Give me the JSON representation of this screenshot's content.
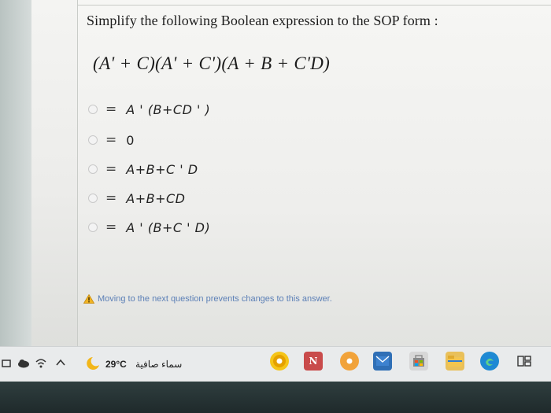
{
  "question": {
    "prompt": "Simplify the following Boolean expression to the SOP form :",
    "expression": "(A' + C)(A' + C')(A + B + C'D)"
  },
  "options": [
    {
      "equals": "=",
      "text": "A ' (B+CD ' )"
    },
    {
      "equals": "=",
      "text": "0"
    },
    {
      "equals": "=",
      "text": "A+B+C ' D"
    },
    {
      "equals": "=",
      "text": "A+B+CD"
    },
    {
      "equals": "=",
      "text": "A ' (B+C ' D)"
    }
  ],
  "warning": {
    "icon": "warning-triangle-icon",
    "text": "Moving to the next question prevents changes to this answer."
  },
  "taskbar": {
    "weather_temp": "29°C",
    "weather_label": "سماء صافية",
    "icons": [
      "snip-icon",
      "cloud-icon",
      "wifi-icon",
      "chevron-up-icon",
      "weather-icon",
      "chrome-icon",
      "word-icon",
      "chrome-alt-icon",
      "mail-icon",
      "store-icon",
      "file-explorer-icon",
      "edge-icon",
      "task-view-icon"
    ]
  },
  "colors": {
    "warning_text": "#5b7fb6",
    "warning_icon": "#f0b323",
    "radio_border": "#c9c9c9",
    "taskbar": "#e9ebec"
  }
}
